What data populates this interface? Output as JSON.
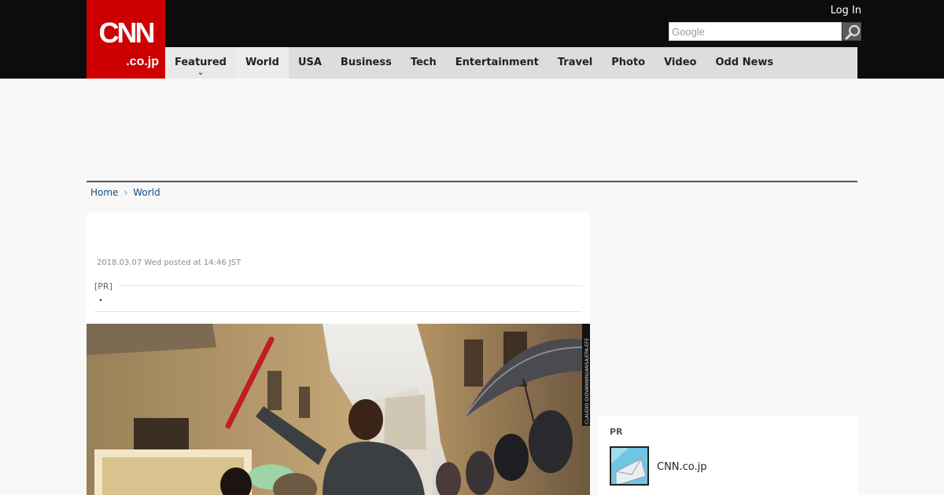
{
  "header": {
    "logo": {
      "main": "CNN",
      "sub": ".co.jp"
    },
    "login_label": "Log In",
    "search": {
      "placeholder": "Google",
      "value": "",
      "button_icon": "magnifier-icon"
    }
  },
  "nav": {
    "items": [
      {
        "label": "Featured",
        "has_dropdown": true
      },
      {
        "label": "World",
        "active": true
      },
      {
        "label": "USA"
      },
      {
        "label": "Business"
      },
      {
        "label": "Tech"
      },
      {
        "label": "Entertainment"
      },
      {
        "label": "Travel"
      },
      {
        "label": "Photo"
      },
      {
        "label": "Video"
      },
      {
        "label": "Odd News"
      }
    ]
  },
  "breadcrumb": {
    "items": [
      {
        "label": "Home"
      },
      {
        "label": "World"
      }
    ],
    "separator": "›"
  },
  "article": {
    "timestamp": "2018.03.07 Wed posted at 14:46 JST",
    "pr_label": "[PR]",
    "pr_text": "・",
    "photo_credit": "CLAUDIO GIOVANNINI/ANSA/EPA-EFE"
  },
  "sidebar": {
    "pr_title": "PR",
    "pr_item": {
      "label": "CNN.co.jp",
      "icon": "envelope-icon"
    }
  },
  "colors": {
    "brand_red": "#cc0000",
    "topbar": "#0c0c0c",
    "nav_bg": "#dddddd",
    "link": "#0d4f8a"
  }
}
